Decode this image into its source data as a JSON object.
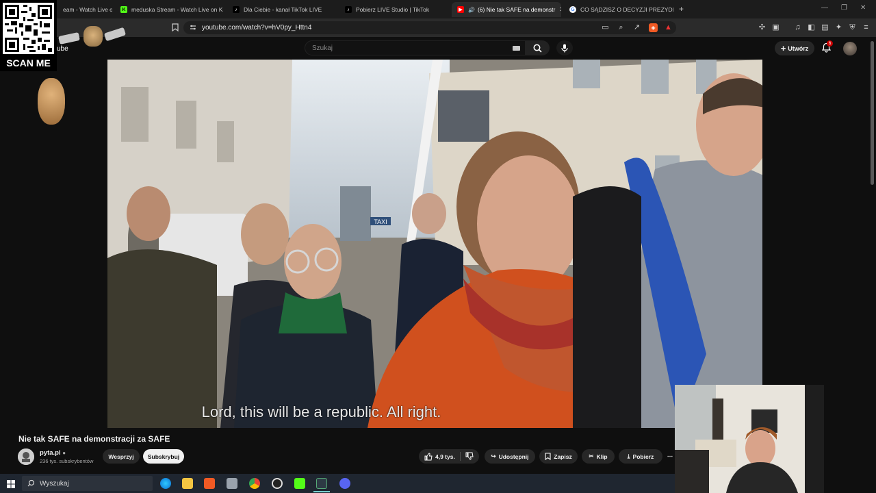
{
  "browser": {
    "tabs": [
      {
        "title": "eam - Watch Live on",
        "active": false
      },
      {
        "title": "meduska Stream - Watch Live on Kick",
        "active": false
      },
      {
        "title": "Dla Ciebie - kanał TikTok LIVE",
        "active": false
      },
      {
        "title": "Pobierz LIVE Studio | TikTok",
        "active": false
      },
      {
        "title": "(6) Nie tak SAFE na demonstr",
        "active": true
      },
      {
        "title": "CO SĄDZISZ O DECYZJI PREZYDENTA",
        "active": false
      }
    ],
    "new_tab_label": "+",
    "url": "youtube.com/watch?v=hV0py_Httn4"
  },
  "overlay": {
    "scan_me": "SCAN ME"
  },
  "youtube": {
    "logo_partial": "ube",
    "search_placeholder": "Szukaj",
    "create_label": "Utwórz",
    "notification_count": "6"
  },
  "video": {
    "subtitle": "Lord, this will be a republic.  All right.",
    "taxi_sign": "TAXI",
    "title": "Nie tak SAFE na demonstracji za SAFE"
  },
  "channel": {
    "name": "pyta.pl",
    "subscribers": "236 tys. subskrybentów",
    "support_label": "Wesprzyj",
    "subscribe_label": "Subskrybuj"
  },
  "actions": {
    "likes": "4,9 tys.",
    "share_label": "Udostępnij",
    "save_label": "Zapisz",
    "clip_label": "Klip",
    "download_label": "Pobierz",
    "more_label": "⋯"
  },
  "taskbar": {
    "search_placeholder": "Wyszukaj"
  },
  "colors": {
    "accent_red": "#ff0000",
    "yt_bg": "#0f0f0f",
    "subscribe_bg": "#f1f1f1"
  }
}
